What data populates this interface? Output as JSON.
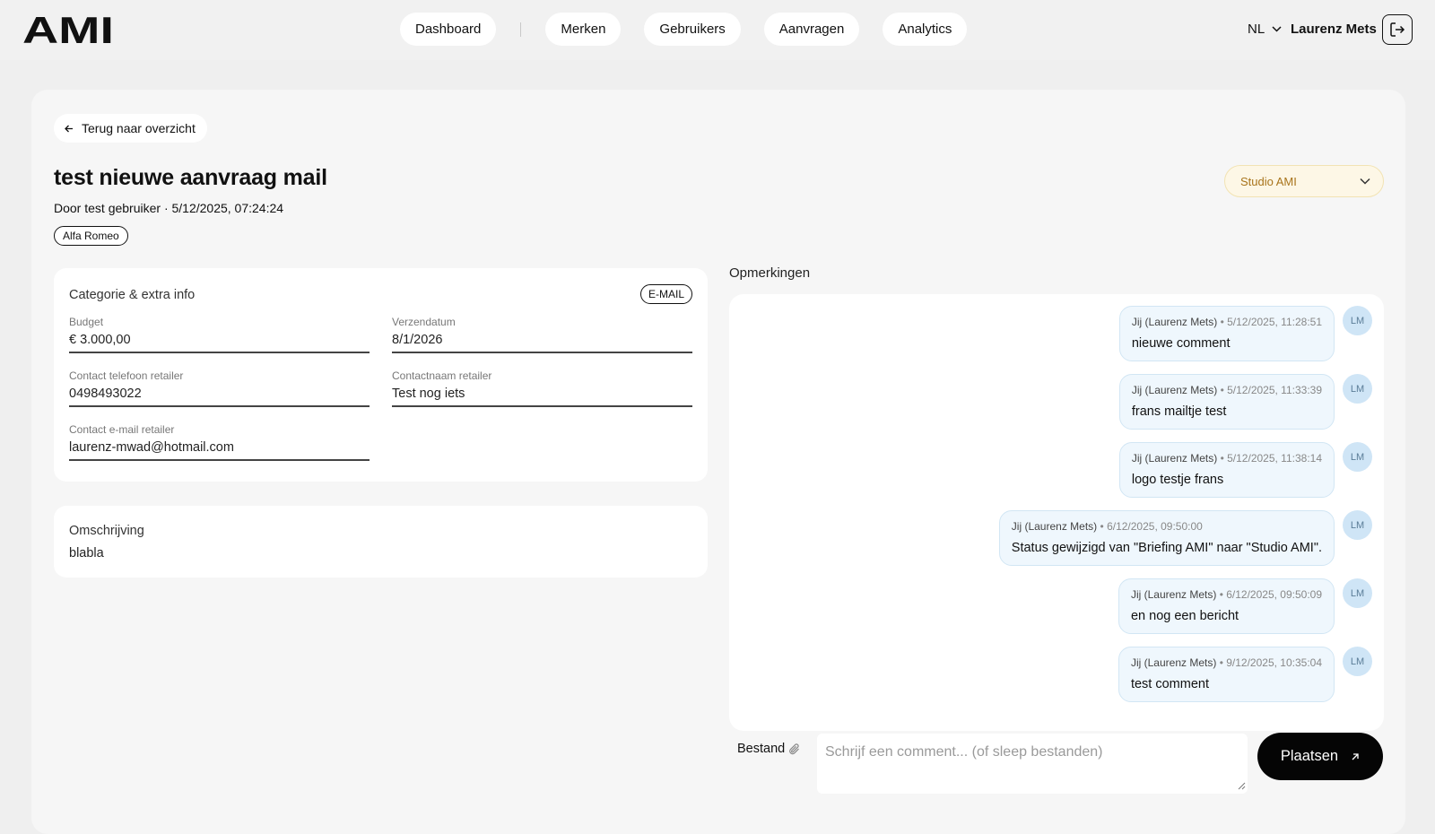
{
  "header": {
    "logo_text": "AMI",
    "nav": [
      {
        "label": "Dashboard"
      },
      {
        "label": "Merken"
      },
      {
        "label": "Gebruikers"
      },
      {
        "label": "Aanvragen"
      },
      {
        "label": "Analytics"
      }
    ],
    "language": "NL",
    "user_name": "Laurenz Mets",
    "icons": {
      "language_dropdown": "chevron-down-icon",
      "logout": "logout-icon"
    }
  },
  "request": {
    "back_label": "Terug naar overzicht",
    "title": "test nieuwe aanvraag mail",
    "subtitle": "Door test gebruiker · 5/12/2025, 07:24:24",
    "brand_tag": "Alfa Romeo",
    "status": {
      "value": "Studio AMI",
      "color": "#a8741b",
      "background": "#fdf7e6"
    }
  },
  "info_card": {
    "title": "Categorie & extra info",
    "badge": "E-MAIL",
    "fields": [
      {
        "label": "Budget",
        "value": "€ 3.000,00"
      },
      {
        "label": "Verzendatum",
        "value": "8/1/2026"
      },
      {
        "label": "Contact telefoon retailer",
        "value": "0498493022"
      },
      {
        "label": "Contactnaam retailer",
        "value": "Test nog iets"
      },
      {
        "label": "Contact e-mail retailer",
        "value": "laurenz-mwad@hotmail.com"
      }
    ]
  },
  "description": {
    "title": "Omschrijving",
    "text": "blabla"
  },
  "comments": {
    "title": "Opmerkingen",
    "items": [
      {
        "author": "Jij (Laurenz Mets)",
        "datetime": "5/12/2025, 11:28:51",
        "text": "nieuwe comment",
        "avatar": "LM"
      },
      {
        "author": "Jij (Laurenz Mets)",
        "datetime": "5/12/2025, 11:33:39",
        "text": "frans mailtje test",
        "avatar": "LM"
      },
      {
        "author": "Jij (Laurenz Mets)",
        "datetime": "5/12/2025, 11:38:14",
        "text": "logo testje frans",
        "avatar": "LM"
      },
      {
        "author": "Jij (Laurenz Mets)",
        "datetime": "6/12/2025, 09:50:00",
        "text": "Status gewijzigd van \"Briefing AMI\" naar \"Studio AMI\".",
        "avatar": "LM"
      },
      {
        "author": "Jij (Laurenz Mets)",
        "datetime": "6/12/2025, 09:50:09",
        "text": "en nog een bericht",
        "avatar": "LM"
      },
      {
        "author": "Jij (Laurenz Mets)",
        "datetime": "9/12/2025, 10:35:04",
        "text": "test comment",
        "avatar": "LM"
      }
    ],
    "separator": "•"
  },
  "composer": {
    "file_label": "Bestand",
    "placeholder": "Schrijf een comment... (of sleep bestanden)",
    "value": "",
    "submit_label": "Plaatsen"
  },
  "colors": {
    "accent_status": "#a8741b",
    "comment_bubble": "#eff7fd",
    "avatar": "#cfe5f6",
    "primary_button": "#050505"
  }
}
